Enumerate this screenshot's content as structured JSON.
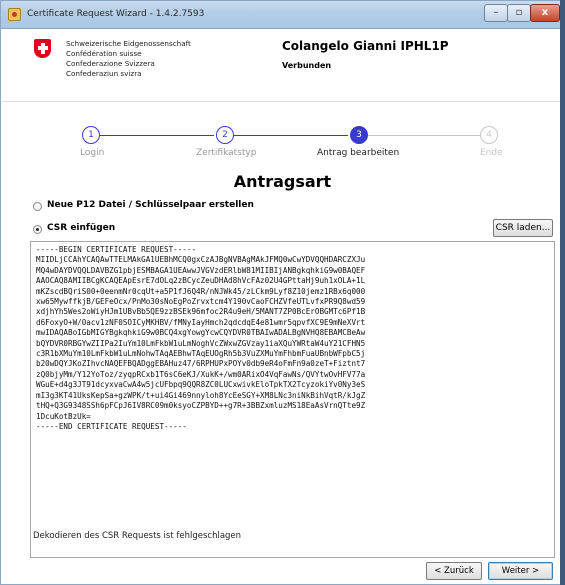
{
  "window": {
    "title": "Certificate Request Wizard - 1.4.2.7593",
    "minimize_label": "–",
    "maximize_label": "▫",
    "close_label": "x"
  },
  "header": {
    "confederation_lines": [
      "Schweizerische Eidgenossenschaft",
      "Confédération suisse",
      "Confederazione Svizzera",
      "Confederaziun svizra"
    ],
    "user_name": "Colangelo Gianni IPHL1P",
    "status": "Verbunden"
  },
  "steps": [
    {
      "number": "1",
      "label": "Login",
      "state": "done"
    },
    {
      "number": "2",
      "label": "Zertifikatstyp",
      "state": "done"
    },
    {
      "number": "3",
      "label": "Antrag bearbeiten",
      "state": "active"
    },
    {
      "number": "4",
      "label": "Ende",
      "state": "disabled"
    }
  ],
  "section": {
    "title": "Antragsart"
  },
  "options": {
    "new_p12": "Neue P12 Datei / Schlüsselpaar erstellen",
    "insert_csr": "CSR einfügen",
    "selected": "insert_csr"
  },
  "buttons": {
    "csr_load": "CSR laden...",
    "back": "< Zurück",
    "next": "Weiter >"
  },
  "csr_content": "-----BEGIN CERTIFICATE REQUEST-----\nMIIDLjCCAhYCAQAwTTELMAkGA1UEBhMCQ0gxCzAJBgNVBAgMAkJFMQ0wCwYDVQQHDARCZXJu\nMQ4wDAYDVQQLDAVBZG1pbjESMBAGA1UEAwwJVGVzdERlbW81MIIBIjANBgkqhkiG9w0BAQEF\nAAOCAQ8AMIIBCgKCAQEApEsrE7dOLq2zBCycZeuDHAd8hVcFAz02U4GPttaHj9uh1xOLA+1L\nmKZscdBQriS00+0eenmNr0cqUt+a5P1fJ6Q4R/nNJWk45/zLCkm9Lyf8Z10jemz1RBx6q000\nxw65MywffkjB/GEFeOcx/PnMo30sNoEgPoZrvxtcm4Y190vCaoFCHZVfeUTLvfxPR9Q8wd59\nxdjhYh5Wes2oWiyHJm1UBvBb5QE9zzBSEk96mfoc2R4u9eH/5MANT7ZP0BcErOBGMTc6Pf1B\nd6FoxyO+W/0acv1zNF0SOICyMKHBV/fMNyIayHmch2qdcdqE4e81wmr5qpvfXC9E9mNeXVrt\nmwIDAQABoIGbMIGYBgkqhkiG9w0BCQ4xgYowgYcwCQYDVR0TBAIwADALBgNVHQ8EBAMCBeAw\nbQYDVR0RBGYwZIIPa2IuYm10LmFkbW1uLmNoghVcZWxwZGVzay1iaXQuYWRtaW4uY21CFHN5\nc3R1bXMuYm10LmFkbW1uLmNohwTAqAEBhwTAqEUOgRh5b3VuZXMuYmFhbmFuaUBnbWFpbC5j\nb20wDQYJKoZIhvcNAQEFBQADggEBAHuz47/6RPHUPxPOYv0db9eR4oFmFn9a0zeT+Fiztnt7\nzQ0bjyMm/Y12YoToz/zyqpRCxb1T6sC6eKJ/XukK+/wm0ARixO4VqFawNs/QVYtwOvHFV77a\nWGuE+d4g3JT91dcyxvaCwA4w5jcUFbpq9QQR8ZC0LUCxwivkEloTpkTX2TcyzokiYv0Ny3eS\nmI3g3KT41UksKepSa+gzWPK/t+ui4Gi469nnyloh8YcEeSGY+XM8LNc3niNkBihVqtR/kJgZ\ntHQ+Q3G9348SSh6pFCpJ6IV8RC09m0ksyoCZPBYD++g7R+3BBZxmluzMS18EaAsVrnQTte9Z\n1DcuKotBzUk=\n-----END CERTIFICATE REQUEST-----",
  "error_message": "Dekodieren des CSR Requests ist fehlgeschlagen"
}
